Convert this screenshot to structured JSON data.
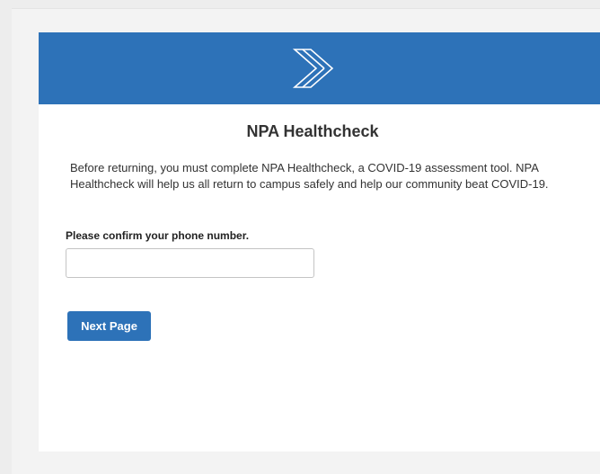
{
  "brand": {
    "logo_icon": "chevron-arrow-logo-icon",
    "banner_color": "#2d72b8"
  },
  "form": {
    "title": "NPA Healthcheck",
    "intro": "Before returning, you must complete NPA Healthcheck, a COVID-19 assessment tool. NPA Healthcheck will help us all return to campus safely and help our community beat COVID-19.",
    "phone_label": "Please confirm your phone number.",
    "phone_value": "",
    "phone_placeholder": "",
    "next_label": "Next Page"
  },
  "colors": {
    "accent": "#2d72b8",
    "background": "#f3f3f3",
    "card": "#ffffff"
  }
}
